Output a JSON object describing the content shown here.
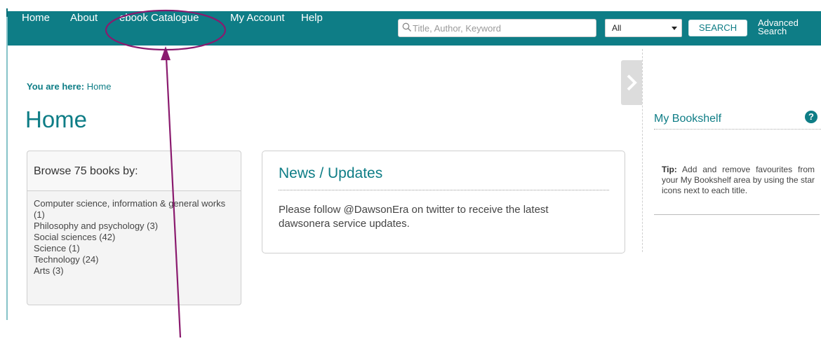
{
  "nav": {
    "items": [
      "Home",
      "About",
      "ebook Catalogue",
      "My Account",
      "Help"
    ],
    "search_placeholder": "Title, Author, Keyword",
    "scope_value": "All",
    "search_button": "SEARCH",
    "advanced_search": "Advanced Search"
  },
  "breadcrumb": {
    "prefix": "You are here:",
    "current": "Home"
  },
  "page_title": "Home",
  "browse": {
    "heading": "Browse 75 books by:",
    "categories": [
      "Computer science, information & general works (1)",
      "Philosophy and psychology (3)",
      "Social sciences (42)",
      "Science (1)",
      "Technology (24)",
      "Arts (3)"
    ]
  },
  "news": {
    "title": "News / Updates",
    "body": "Please follow @DawsonEra on twitter to receive the latest dawsonera service updates."
  },
  "bookshelf": {
    "title": "My Bookshelf",
    "help_glyph": "?",
    "tip_label": "Tip:",
    "tip_text": " Add and remove favourites from your My Bookshelf area by using the star icons next to each title."
  },
  "colors": {
    "brand": "#0e7d86",
    "annotation": "#8a1a6e"
  }
}
